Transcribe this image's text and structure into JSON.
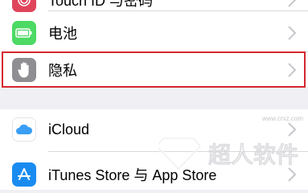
{
  "settings": {
    "rows": [
      {
        "label": "Touch ID 与密码",
        "icon": "fingerprint-icon",
        "icon_color": "#e0445b"
      },
      {
        "label": "电池",
        "icon": "battery-icon",
        "icon_color": "#4cd964"
      },
      {
        "label": "隐私",
        "icon": "hand-icon",
        "icon_color": "#8e8e93"
      },
      {
        "label": "iCloud",
        "icon": "cloud-icon",
        "icon_color": "#ffffff"
      },
      {
        "label": "iTunes Store 与 App Store",
        "icon": "app-store-icon",
        "icon_color": "#1a8cf0"
      }
    ]
  },
  "watermark": {
    "site": "www.crxz.com",
    "text": "超人软件"
  },
  "colors": {
    "highlight": "#d6262f",
    "background": "#efeff4",
    "chevron": "#c7c7cc"
  }
}
